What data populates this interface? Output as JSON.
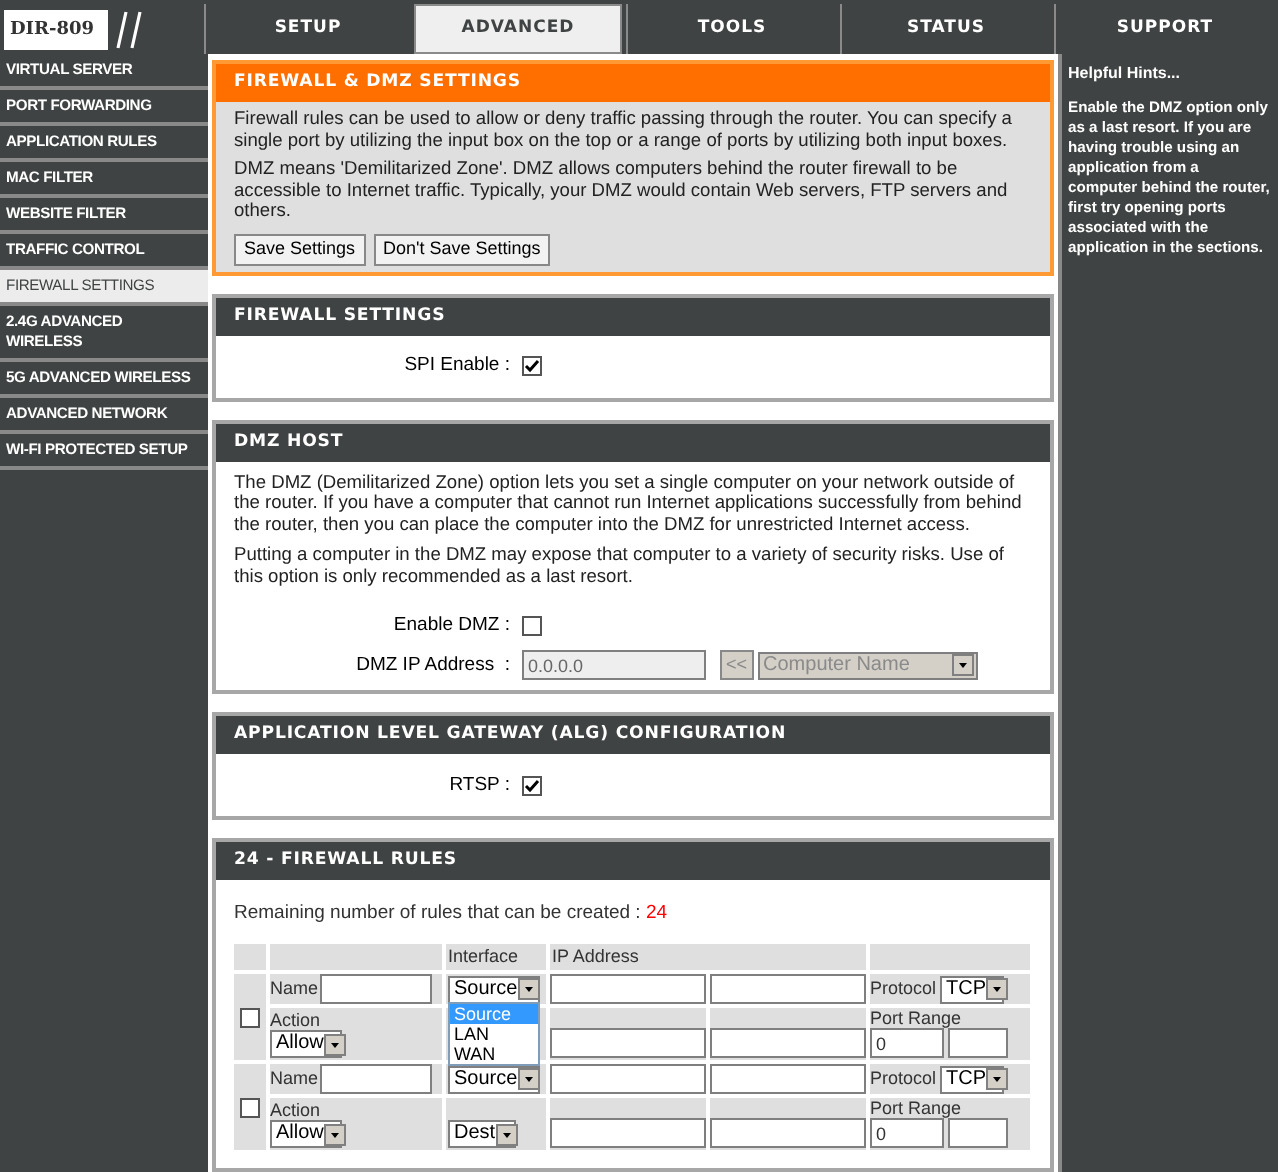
{
  "nav": {
    "model": "DIR-809",
    "tabs": [
      {
        "label": "SETUP",
        "selected": false
      },
      {
        "label": "ADVANCED",
        "selected": true
      },
      {
        "label": "TOOLS",
        "selected": false
      },
      {
        "label": "STATUS",
        "selected": false
      },
      {
        "label": "SUPPORT",
        "selected": false
      }
    ]
  },
  "sidebar": {
    "items": [
      {
        "label": "VIRTUAL SERVER",
        "selected": false
      },
      {
        "label": "PORT FORWARDING",
        "selected": false
      },
      {
        "label": "APPLICATION RULES",
        "selected": false
      },
      {
        "label": "MAC FILTER",
        "selected": false
      },
      {
        "label": "WEBSITE FILTER",
        "selected": false
      },
      {
        "label": "TRAFFIC CONTROL",
        "selected": false
      },
      {
        "label": "FIREWALL SETTINGS",
        "selected": true
      },
      {
        "label": "2.4G ADVANCED WIRELESS",
        "selected": false
      },
      {
        "label": "5G ADVANCED WIRELESS",
        "selected": false
      },
      {
        "label": "ADVANCED NETWORK",
        "selected": false
      },
      {
        "label": "WI-FI PROTECTED SETUP",
        "selected": false
      }
    ]
  },
  "intro": {
    "title": "FIREWALL & DMZ SETTINGS",
    "paragraphs": [
      "Firewall rules can be used to allow or deny traffic passing through the router. You can specify a single port by utilizing the input box on the top or a range of ports by utilizing both input boxes.",
      "DMZ means 'Demilitarized Zone'. DMZ allows computers behind the router firewall to be accessible to Internet traffic. Typically, your DMZ would contain Web servers, FTP servers and others."
    ],
    "buttons": [
      "Save Settings",
      "Don't Save Settings"
    ]
  },
  "firewall_settings": {
    "title": "FIREWALL SETTINGS",
    "spi": {
      "label": "SPI Enable :",
      "checked": true
    }
  },
  "dmz_host": {
    "title": "DMZ HOST",
    "paragraphs": [
      "The DMZ (Demilitarized Zone) option lets you set a single computer on your network outside of the router. If you have a computer that cannot run Internet applications successfully from behind the router, then you can place the computer into the DMZ for unrestricted Internet access.",
      "Putting a computer in the DMZ may expose that computer to a variety of security risks. Use of this option is only recommended as a last resort."
    ],
    "enable": {
      "label": "Enable DMZ :",
      "checked": false
    },
    "ip": {
      "label": "DMZ IP Address  :",
      "value": "0.0.0.0",
      "disabled": true
    },
    "copy_button": "<<",
    "computer_name": "Computer Name"
  },
  "alg": {
    "title": "APPLICATION LEVEL GATEWAY (ALG) CONFIGURATION",
    "rtsp": {
      "label": "RTSP :",
      "checked": true
    }
  },
  "rules": {
    "title": "24 - FIREWALL RULES",
    "remaining_label": "Remaining number of rules that can be created :",
    "remaining_count": "24",
    "columns": [
      "Interface",
      "IP Address"
    ],
    "rows": [
      {
        "checked": false,
        "name_label": "Name",
        "action_label": "Action",
        "action": "Allow",
        "source": "Source",
        "protocol_label": "Protocol",
        "protocol": "TCP",
        "port_range_label": "Port Range",
        "port_start": "0",
        "open_menu": [
          {
            "label": "Source",
            "selected": true
          },
          {
            "label": "LAN",
            "selected": false
          },
          {
            "label": "WAN",
            "selected": false
          }
        ]
      },
      {
        "checked": false,
        "name_label": "Name",
        "action_label": "Action",
        "action": "Allow",
        "source": "Source",
        "dest": "Dest",
        "protocol_label": "Protocol",
        "protocol": "TCP",
        "port_range_label": "Port Range",
        "port_start": "0"
      }
    ]
  },
  "hints": {
    "title": "Helpful Hints...",
    "text": "Enable the DMZ option only as a last resort. If you are having trouble using an application from a computer behind the router, first try opening ports associated with the application in the sections."
  }
}
